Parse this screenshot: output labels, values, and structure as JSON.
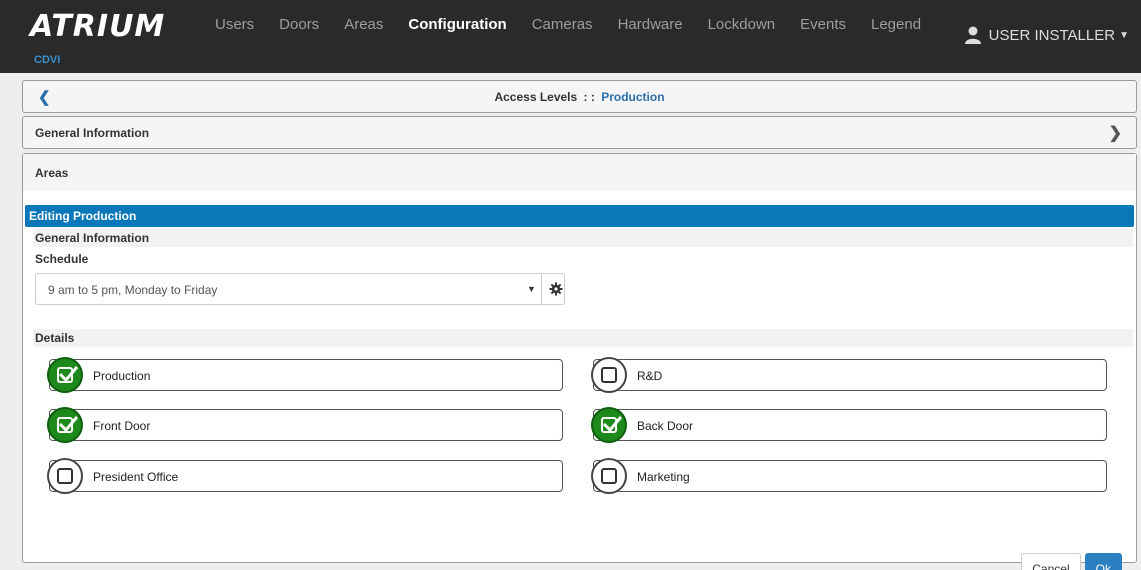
{
  "brand": {
    "name": "ATRIUM",
    "sub": "CDVI"
  },
  "nav": [
    {
      "label": "Users"
    },
    {
      "label": "Doors"
    },
    {
      "label": "Areas"
    },
    {
      "label": "Configuration",
      "active": true
    },
    {
      "label": "Cameras"
    },
    {
      "label": "Hardware"
    },
    {
      "label": "Lockdown"
    },
    {
      "label": "Events"
    },
    {
      "label": "Legend"
    }
  ],
  "user": {
    "name": "USER INSTALLER",
    "icon": "user-icon"
  },
  "header": {
    "back_icon": "chevron-left-icon",
    "title_prefix": "Access Levels",
    "separator": ": :",
    "title_link": "Production"
  },
  "general_panel": {
    "label": "General Information",
    "icon": "chevron-right-icon"
  },
  "areas": {
    "label": "Areas",
    "editing": "Editing Production",
    "general_info": "General Information",
    "schedule_label": "Schedule",
    "schedule_value": "9 am to 5 pm, Monday to Friday",
    "details_label": "Details",
    "items": [
      {
        "name": "Production",
        "checked": true
      },
      {
        "name": "R&D",
        "checked": false
      },
      {
        "name": "Front Door",
        "checked": true
      },
      {
        "name": "Back Door",
        "checked": true
      },
      {
        "name": "President Office",
        "checked": false
      },
      {
        "name": "Marketing",
        "checked": false
      }
    ]
  },
  "actions": {
    "cancel": "Cancel",
    "ok": "Ok"
  },
  "colors": {
    "topbar": "#2a2a2a",
    "accent": "#0a77b9",
    "checked": "#1e8a1e"
  }
}
